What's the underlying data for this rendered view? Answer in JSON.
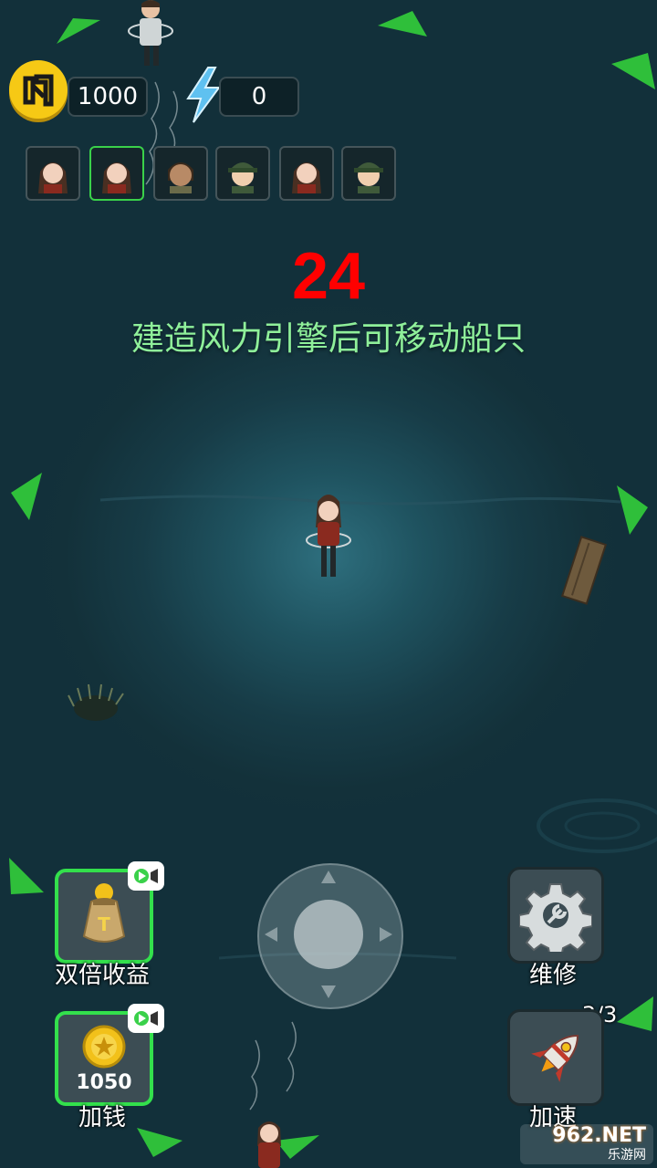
{
  "hud": {
    "coins": "1000",
    "energy": "0"
  },
  "survivors": [
    {
      "name": "survivor-1"
    },
    {
      "name": "survivor-2"
    },
    {
      "name": "survivor-3"
    },
    {
      "name": "survivor-4"
    },
    {
      "name": "survivor-5"
    },
    {
      "name": "survivor-6"
    }
  ],
  "countdown": "24",
  "hint": "建造风力引擎后可移动船只",
  "actions": {
    "double_income": "双倍收益",
    "add_money_amount": "1050",
    "add_money": "加钱",
    "repair": "维修",
    "speed_up": "加速",
    "speed_up_count": "3/3"
  },
  "watermark": {
    "brand": "962.NET",
    "subtitle": "乐游网"
  },
  "colors": {
    "countdown": "#ff0000",
    "hint": "#8ff09a",
    "selected_border": "#33e04c",
    "coin": "#f6c915"
  }
}
